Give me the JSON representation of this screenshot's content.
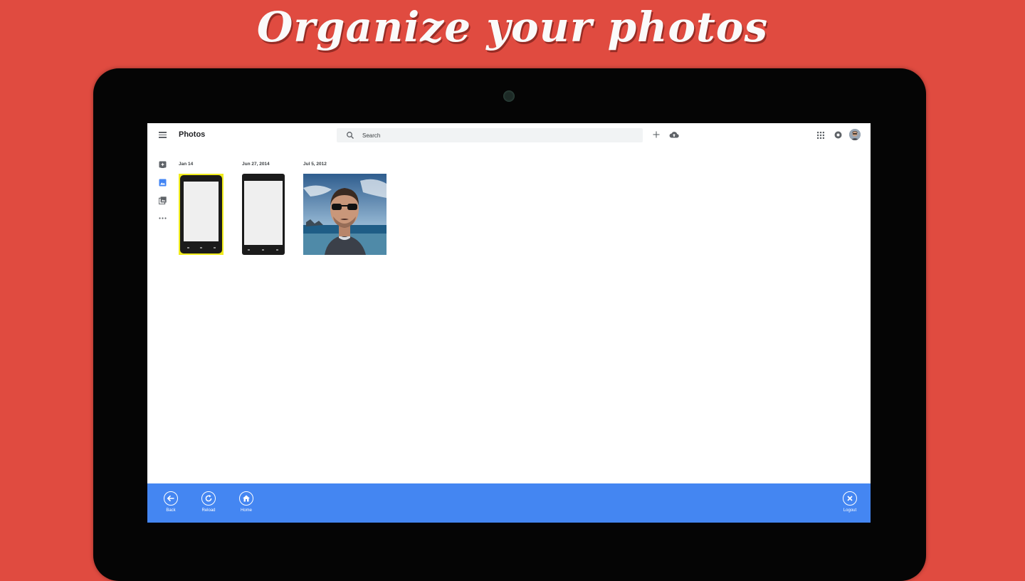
{
  "promo": {
    "headline": "Organize your photos"
  },
  "header": {
    "title": "Photos",
    "search": {
      "placeholder": "Search",
      "value": ""
    }
  },
  "icons": {
    "menu": "hamburger-menu-icon",
    "search": "search-icon",
    "add": "plus-icon",
    "upload": "cloud-upload-icon",
    "apps": "apps-grid-icon",
    "notifications": "notifications-icon",
    "avatar": "user-avatar",
    "rail": [
      "assistant-icon",
      "photos-icon",
      "albums-icon",
      "more-icon"
    ]
  },
  "photos": [
    {
      "date": "Jan 14",
      "subject": "yellow Windows phone",
      "selected": true
    },
    {
      "date": "Jun 27, 2014",
      "subject": "black Windows phone",
      "selected": false
    },
    {
      "date": "Jul 5, 2012",
      "subject": "man with sunglasses by the sea",
      "selected": false
    }
  ],
  "appbar": {
    "back": "Back",
    "reload": "Reload",
    "home": "Home",
    "logout": "Logout"
  },
  "colors": {
    "background": "#e04b40",
    "accent": "#4486f2",
    "selection": "#f0eb1c",
    "rail_active": "#4285f4"
  }
}
